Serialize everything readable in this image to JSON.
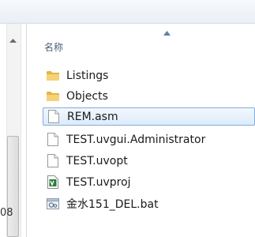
{
  "nav": {
    "partial_text": "08"
  },
  "file_list": {
    "column_header": "名称",
    "items": [
      {
        "name": "Listings",
        "icon": "folder-icon",
        "selected": false
      },
      {
        "name": "Objects",
        "icon": "folder-icon",
        "selected": false
      },
      {
        "name": "REM.asm",
        "icon": "document-icon",
        "selected": true
      },
      {
        "name": "TEST.uvgui.Administrator",
        "icon": "document-icon",
        "selected": false
      },
      {
        "name": "TEST.uvopt",
        "icon": "document-icon",
        "selected": false
      },
      {
        "name": "TEST.uvproj",
        "icon": "uvision-project-icon",
        "selected": false
      },
      {
        "name": "金水151_DEL.bat",
        "icon": "batch-file-icon",
        "selected": false
      }
    ]
  },
  "colors": {
    "selection_border": "#84acdd",
    "selection_fill": "#dcebfc",
    "header_text": "#4c607a",
    "folder": "#e9c25a"
  }
}
